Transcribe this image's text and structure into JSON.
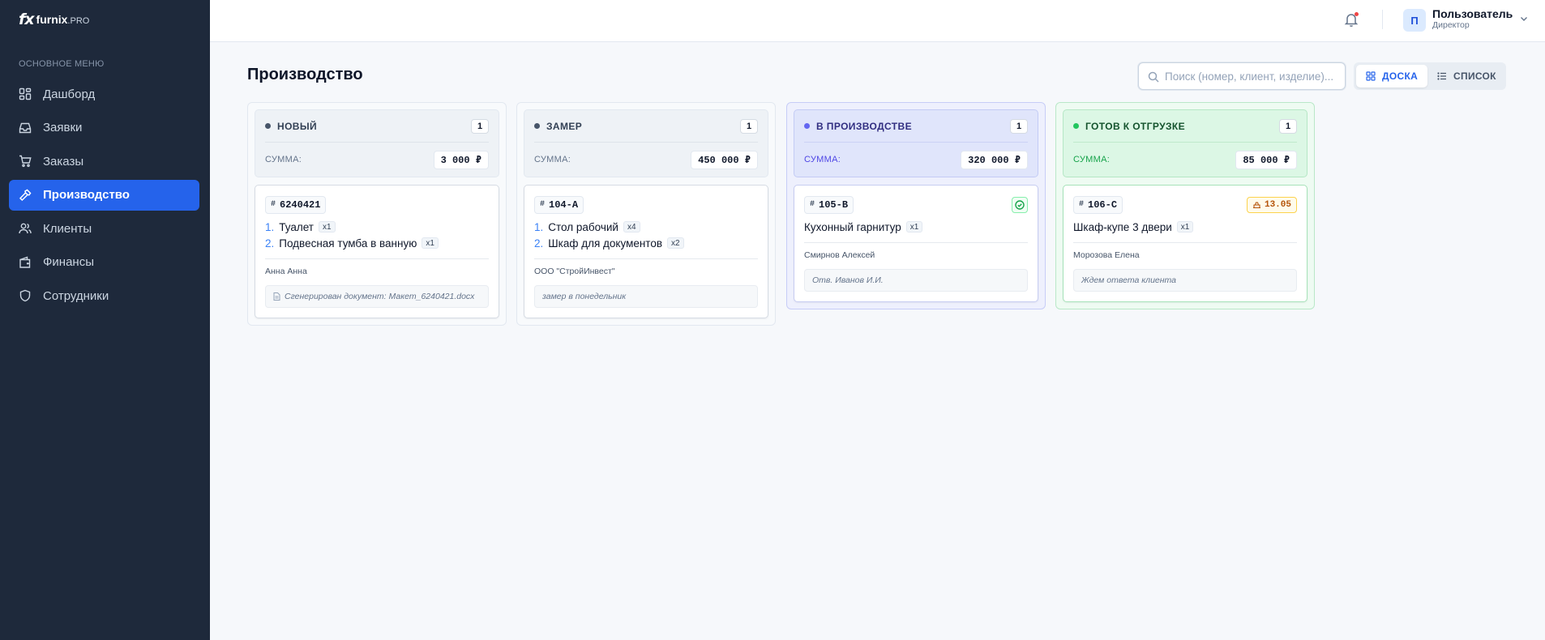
{
  "app": {
    "logo_mark": "fx",
    "logo_name": "furnix",
    "logo_suffix": ".PRO"
  },
  "sidebar": {
    "heading": "ОСНОВНОЕ МЕНЮ",
    "items": [
      {
        "label": "Дашборд",
        "icon": "dashboard-icon"
      },
      {
        "label": "Заявки",
        "icon": "inbox-icon"
      },
      {
        "label": "Заказы",
        "icon": "cart-icon"
      },
      {
        "label": "Производство",
        "icon": "hammer-icon",
        "active": true
      },
      {
        "label": "Клиенты",
        "icon": "users-icon"
      },
      {
        "label": "Финансы",
        "icon": "wallet-icon"
      },
      {
        "label": "Сотрудники",
        "icon": "shield-icon"
      }
    ]
  },
  "topbar": {
    "user_initial": "П",
    "user_name": "Пользователь",
    "user_role": "Директор",
    "has_notification": true
  },
  "page": {
    "title": "Производство",
    "search_placeholder": "Поиск (номер, клиент, изделие)...",
    "view_board": "ДОСКА",
    "view_list": "СПИСОК"
  },
  "colors": {
    "accent": "#2563eb",
    "new": "#475569",
    "measure": "#475569",
    "production": "#6366f1",
    "ready": "#22c55e"
  },
  "columns": [
    {
      "title": "НОВЫЙ",
      "count": "1",
      "sum_label": "СУММА:",
      "sum": "3 000 ₽",
      "cards": [
        {
          "number": "6240421",
          "items": [
            {
              "num": "1.",
              "name": "Туалет",
              "qty": "x1"
            },
            {
              "num": "2.",
              "name": "Подвесная тумба в ванную",
              "qty": "x1"
            }
          ],
          "client": "Анна Анна",
          "note": "Сгенерирован документ: Макет_6240421.docx"
        }
      ]
    },
    {
      "title": "ЗАМЕР",
      "count": "1",
      "sum_label": "СУММА:",
      "sum": "450 000 ₽",
      "cards": [
        {
          "number": "104-A",
          "items": [
            {
              "num": "1.",
              "name": "Стол рабочий",
              "qty": "x4"
            },
            {
              "num": "2.",
              "name": "Шкаф для документов",
              "qty": "x2"
            }
          ],
          "client": "ООО \"СтройИнвест\"",
          "note": "замер в понедельник"
        }
      ]
    },
    {
      "title": "В ПРОИЗВОДСТВЕ",
      "count": "1",
      "sum_label": "СУММА:",
      "sum": "320 000 ₽",
      "cards": [
        {
          "number": "105-B",
          "items": [
            {
              "name": "Кухонный гарнитур",
              "qty": "x1"
            }
          ],
          "client": "Смирнов Алексей",
          "note": "Отв. Иванов И.И."
        }
      ]
    },
    {
      "title": "ГОТОВ К ОТГРУЗКЕ",
      "count": "1",
      "sum_label": "СУММА:",
      "sum": "85 000 ₽",
      "cards": [
        {
          "number": "106-C",
          "date": "13.05",
          "items": [
            {
              "name": "Шкаф-купе 3 двери",
              "qty": "x1"
            }
          ],
          "client": "Морозова Елена",
          "note": "Ждем ответа клиента"
        }
      ]
    }
  ]
}
